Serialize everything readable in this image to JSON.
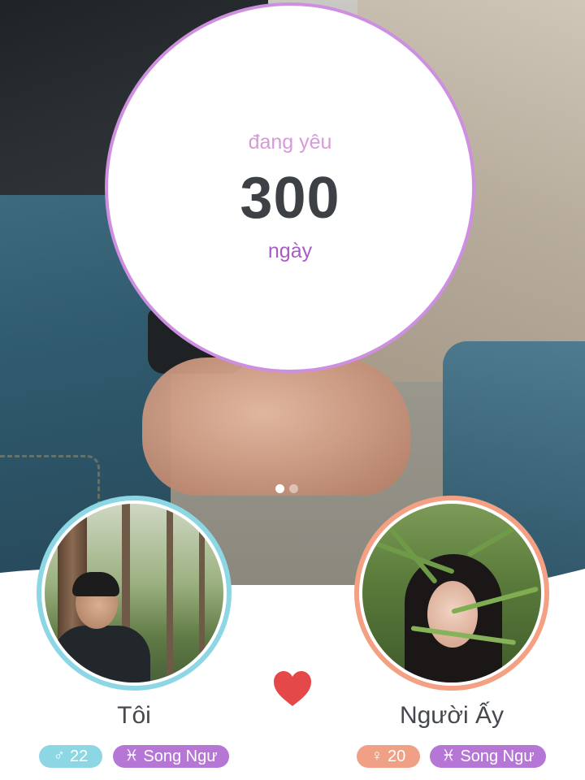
{
  "counter": {
    "top_label": "đang yêu",
    "days": "300",
    "unit_label": "ngày"
  },
  "pager": {
    "page_count": 2,
    "active_index": 0
  },
  "me": {
    "name": "Tôi",
    "gender_icon": "male-icon",
    "gender_symbol": "♂",
    "age": "22",
    "zodiac_icon": "pisces-icon",
    "zodiac_symbol": "♓︎",
    "zodiac": "Song Ngư",
    "ring_color": "#8dd7e5"
  },
  "partner": {
    "name": "Người Ấy",
    "gender_icon": "female-icon",
    "gender_symbol": "♀",
    "age": "20",
    "zodiac_icon": "pisces-icon",
    "zodiac_symbol": "♓︎",
    "zodiac": "Song Ngư",
    "ring_color": "#f3a083"
  },
  "heart": {
    "icon": "heart-icon",
    "color": "#e54848"
  },
  "colors": {
    "counter_ring": "#cf8fe0",
    "zodiac_chip": "#b676d6",
    "days_text": "#3d4146"
  }
}
